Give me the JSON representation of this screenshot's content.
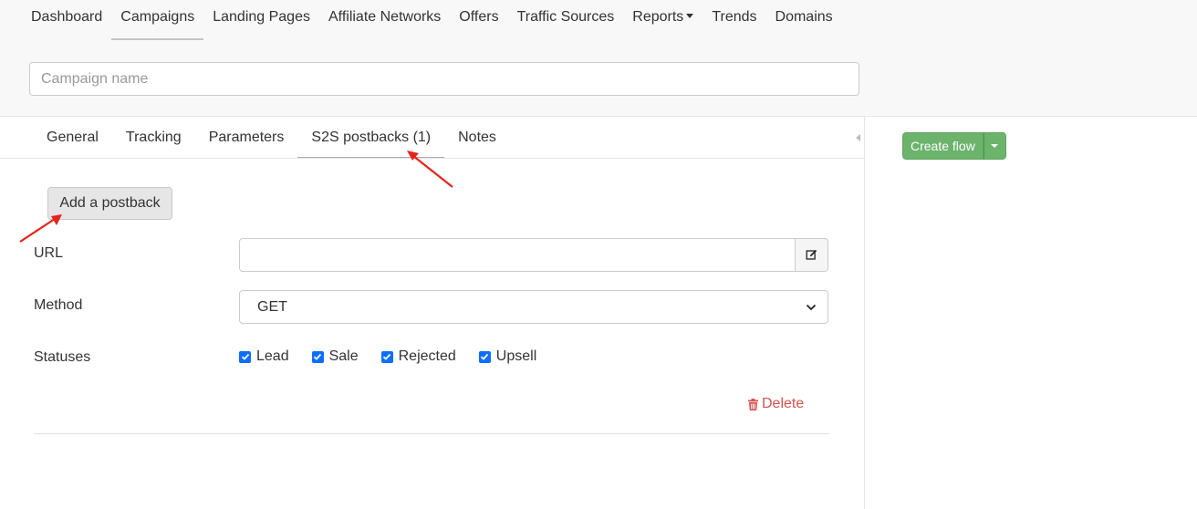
{
  "nav": {
    "items": [
      {
        "label": "Dashboard"
      },
      {
        "label": "Campaigns",
        "active": true
      },
      {
        "label": "Landing Pages"
      },
      {
        "label": "Affiliate Networks"
      },
      {
        "label": "Offers"
      },
      {
        "label": "Traffic Sources"
      },
      {
        "label": "Reports",
        "dropdown": true
      },
      {
        "label": "Trends"
      },
      {
        "label": "Domains"
      }
    ]
  },
  "campaign": {
    "name_value": "",
    "name_placeholder": "Campaign name"
  },
  "tabs": [
    {
      "label": "General"
    },
    {
      "label": "Tracking"
    },
    {
      "label": "Parameters"
    },
    {
      "label": "S2S postbacks (1)",
      "active": true
    },
    {
      "label": "Notes"
    }
  ],
  "postback": {
    "add_button": "Add a postback",
    "url_label": "URL",
    "url_value": "",
    "method_label": "Method",
    "method_value": "GET",
    "statuses_label": "Statuses",
    "statuses": [
      {
        "label": "Lead",
        "checked": true
      },
      {
        "label": "Sale",
        "checked": true
      },
      {
        "label": "Rejected",
        "checked": true
      },
      {
        "label": "Upsell",
        "checked": true
      }
    ],
    "delete_label": "Delete"
  },
  "flow": {
    "create_label": "Create flow"
  },
  "colors": {
    "checkbox": "#0d6efd",
    "delete": "#d9534f",
    "create_flow": "#6cb36c",
    "annotation_arrow": "#e8231b"
  },
  "icons": {
    "url_edit": "edit-icon",
    "delete": "trash-icon",
    "select": "chevron-down-icon"
  }
}
